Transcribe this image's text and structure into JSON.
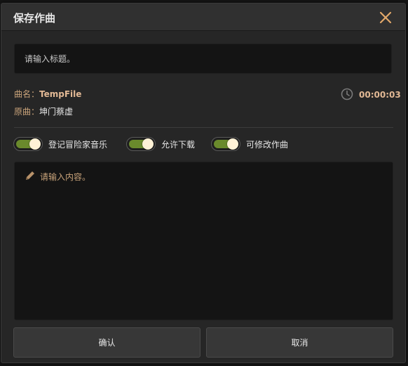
{
  "dialog": {
    "title": "保存作曲",
    "close_icon": "close-icon"
  },
  "title_field": {
    "placeholder": "请输入标题。",
    "value": ""
  },
  "meta": {
    "song_label": "曲名：",
    "song_name": "TempFile",
    "original_label": "原曲：",
    "original_name": "坤门蔡虚",
    "duration": "00:00:03",
    "duration_icon": "clock-icon"
  },
  "toggles": [
    {
      "label": "登记冒险家音乐",
      "on": true
    },
    {
      "label": "允许下载",
      "on": true
    },
    {
      "label": "可修改作曲",
      "on": true
    }
  ],
  "content_field": {
    "placeholder": "请输入内容。",
    "icon": "pencil-icon"
  },
  "buttons": {
    "confirm": "确认",
    "cancel": "取消"
  },
  "colors": {
    "accent_gold": "#e2b995",
    "toggle_on": "#6a8a2c",
    "panel_bg": "#262626",
    "field_bg": "#141414"
  }
}
